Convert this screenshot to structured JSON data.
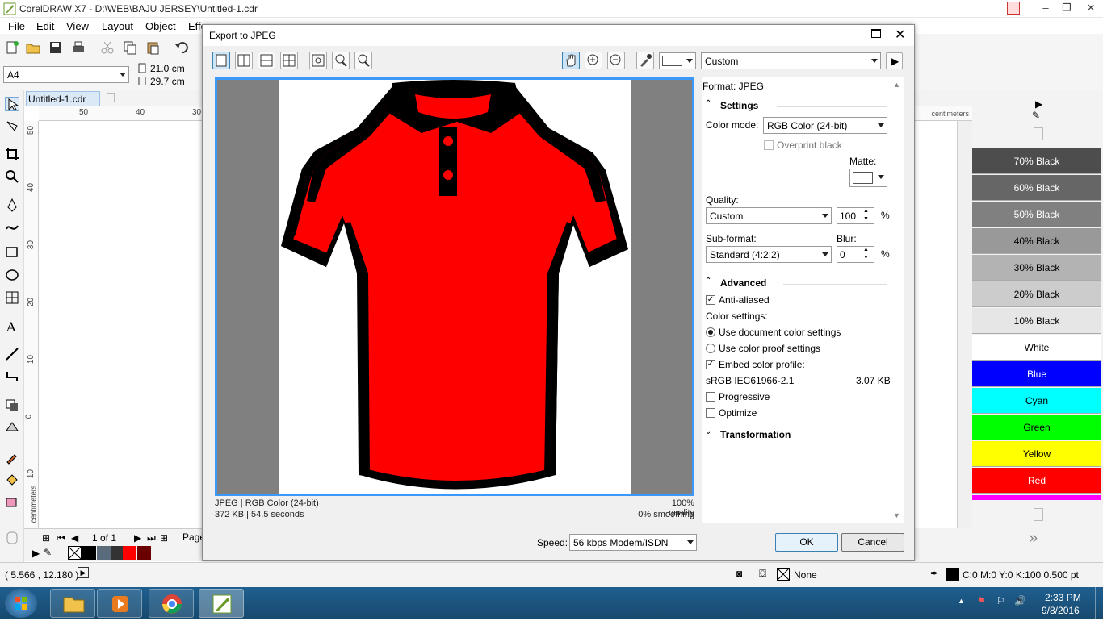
{
  "app": {
    "title": "CorelDRAW X7 - D:\\WEB\\BAJU JERSEY\\Untitled-1.cdr"
  },
  "menu": [
    "File",
    "Edit",
    "View",
    "Layout",
    "Object",
    "Effe"
  ],
  "propbar": {
    "page_size": "A4",
    "width": "21.0 cm",
    "height": "29.7 cm"
  },
  "document": {
    "tab": "Untitled-1.cdr",
    "units": "centimeters",
    "ruler_h": [
      "50",
      "40",
      "30"
    ],
    "ruler_v": [
      "50",
      "40",
      "30",
      "20",
      "10",
      "0",
      "10"
    ],
    "page_info": "1 of 1",
    "page_label": "Page"
  },
  "dialog": {
    "title": "Export to JPEG",
    "preset": "Custom",
    "format": "Format: JPEG",
    "info_left_1": "JPEG  |  RGB Color (24-bit)",
    "info_left_2": "372 KB  |  54.5 seconds",
    "info_right_1": "100% quality",
    "info_right_2": "0% smoothing",
    "settings": {
      "header": "Settings",
      "color_mode_label": "Color mode:",
      "color_mode": "RGB Color (24-bit)",
      "overprint": "Overprint black",
      "matte_label": "Matte:",
      "quality_label": "Quality:",
      "quality": "Custom",
      "quality_value": "100",
      "percent": "%",
      "subformat_label": "Sub-format:",
      "subformat": "Standard (4:2:2)",
      "blur_label": "Blur:",
      "blur_value": "0"
    },
    "advanced": {
      "header": "Advanced",
      "anti_aliased": "Anti-aliased",
      "color_settings": "Color settings:",
      "use_document": "Use document color settings",
      "use_proof": "Use color proof settings",
      "embed_profile": "Embed color profile:",
      "profile": "sRGB IEC61966-2.1",
      "profile_size": "3.07 KB",
      "progressive": "Progressive",
      "optimize": "Optimize"
    },
    "transformation": "Transformation",
    "speed_label": "Speed:",
    "speed": "56 kbps Modem/ISDN",
    "ok": "OK",
    "cancel": "Cancel"
  },
  "palette": [
    {
      "name": "70% Black",
      "color": "#4d4d4d",
      "text": "#ffffff"
    },
    {
      "name": "60% Black",
      "color": "#666666",
      "text": "#ffffff"
    },
    {
      "name": "50% Black",
      "color": "#808080",
      "text": "#ffffff"
    },
    {
      "name": "40% Black",
      "color": "#999999",
      "text": "#000000"
    },
    {
      "name": "30% Black",
      "color": "#b3b3b3",
      "text": "#000000"
    },
    {
      "name": "20% Black",
      "color": "#cccccc",
      "text": "#000000"
    },
    {
      "name": "10% Black",
      "color": "#e6e6e6",
      "text": "#000000"
    },
    {
      "name": "White",
      "color": "#ffffff",
      "text": "#000000"
    },
    {
      "name": "Blue",
      "color": "#0000ff",
      "text": "#ffffff"
    },
    {
      "name": "Cyan",
      "color": "#00ffff",
      "text": "#000000"
    },
    {
      "name": "Green",
      "color": "#00ff00",
      "text": "#000000"
    },
    {
      "name": "Yellow",
      "color": "#ffff00",
      "text": "#000000"
    },
    {
      "name": "Red",
      "color": "#ff0000",
      "text": "#ffffff"
    }
  ],
  "status": {
    "coords": "( 5.566 , 12.180 )",
    "fill": "None",
    "outline": "C:0 M:0 Y:0 K:100  0.500 pt"
  },
  "taskbar": {
    "time": "2:33 PM",
    "date": "9/8/2016"
  }
}
